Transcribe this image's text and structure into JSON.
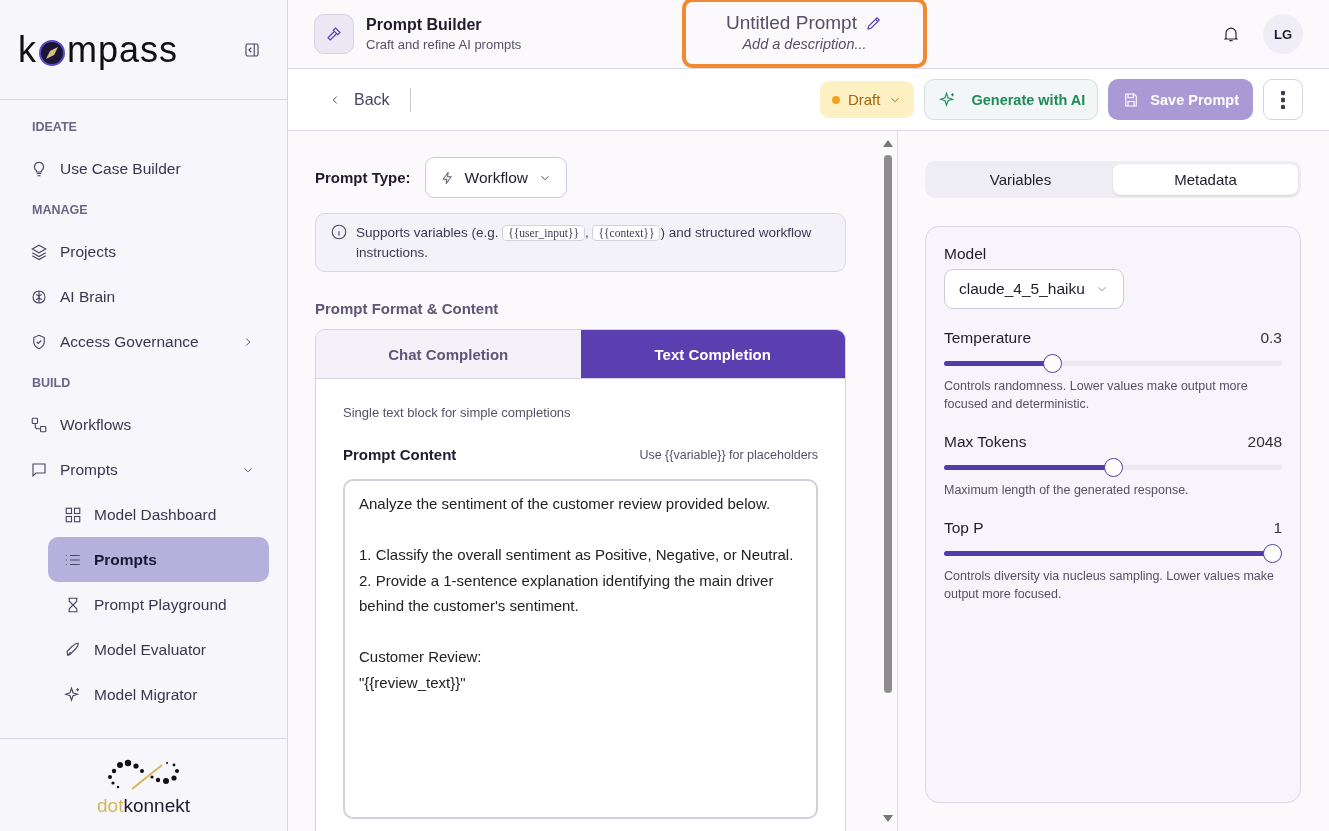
{
  "sidebar": {
    "logo": {
      "before": "k",
      "after": "mpass"
    },
    "sections": [
      {
        "title": "IDEATE",
        "items": [
          {
            "label": "Use Case Builder",
            "selected": false
          }
        ]
      },
      {
        "title": "MANAGE",
        "items": [
          {
            "label": "Projects",
            "selected": false
          },
          {
            "label": "AI Brain",
            "selected": false
          },
          {
            "label": "Access Governance",
            "selected": false,
            "expanded": false
          }
        ]
      },
      {
        "title": "BUILD",
        "items": [
          {
            "label": "Workflows",
            "selected": false
          },
          {
            "label": "Prompts",
            "selected": false,
            "expanded": true,
            "children": [
              {
                "label": "Model Dashboard",
                "selected": false
              },
              {
                "label": "Prompts",
                "selected": true
              },
              {
                "label": "Prompt Playground",
                "selected": false
              },
              {
                "label": "Model Evaluator",
                "selected": false
              },
              {
                "label": "Model Migrator",
                "selected": false
              }
            ]
          }
        ]
      }
    ],
    "footer": {
      "brand_first": "dot",
      "brand_rest": "konnekt"
    }
  },
  "header": {
    "title": "Prompt Builder",
    "subtitle": "Craft and refine AI prompts",
    "prompt_title": "Untitled Prompt",
    "prompt_description_placeholder": "Add a description...",
    "avatar": "LG"
  },
  "toolbar": {
    "back": "Back",
    "status": "Draft",
    "generate": "Generate with AI",
    "save": "Save Prompt",
    "save_disabled": true
  },
  "editor": {
    "type_label": "Prompt Type:",
    "type_value": "Workflow",
    "info": [
      {
        "kind": "text",
        "text": "Supports variables (e.g. "
      },
      {
        "kind": "code",
        "text": "{{user_input}}"
      },
      {
        "kind": "text",
        "text": ", "
      },
      {
        "kind": "code",
        "text": "{{context}}"
      },
      {
        "kind": "text",
        "text": ") and structured workflow instructions."
      }
    ],
    "section_title": "Prompt Format & Content",
    "format_tabs": [
      {
        "label": "Chat Completion",
        "selected": false
      },
      {
        "label": "Text Completion",
        "selected": true
      }
    ],
    "format_hint": "Single text block for simple completions",
    "content_label": "Prompt Content",
    "content_hint": "Use {{variable}} for placeholders",
    "content": "Analyze the sentiment of the customer review provided below.\n\n1. Classify the overall sentiment as Positive, Negative, or Neutral.\n2. Provide a 1-sentence explanation identifying the main driver behind the customer's sentiment.\n\nCustomer Review:\n\"{{review_text}}\""
  },
  "settings": {
    "tabs": [
      {
        "label": "Variables",
        "selected": false
      },
      {
        "label": "Metadata",
        "selected": true
      }
    ],
    "model_label": "Model",
    "model_value": "claude_4_5_haiku",
    "sliders": [
      {
        "label": "Temperature",
        "reading": "0.3",
        "level": 0.31,
        "help": "Controls randomness. Lower values make output more focused and deterministic."
      },
      {
        "label": "Max Tokens",
        "reading": "2048",
        "level": 0.5,
        "help": "Maximum length of the generated response."
      },
      {
        "label": "Top P",
        "reading": "1",
        "level": 1,
        "help": "Controls diversity via nucleus sampling. Lower values make output more focused."
      }
    ]
  }
}
